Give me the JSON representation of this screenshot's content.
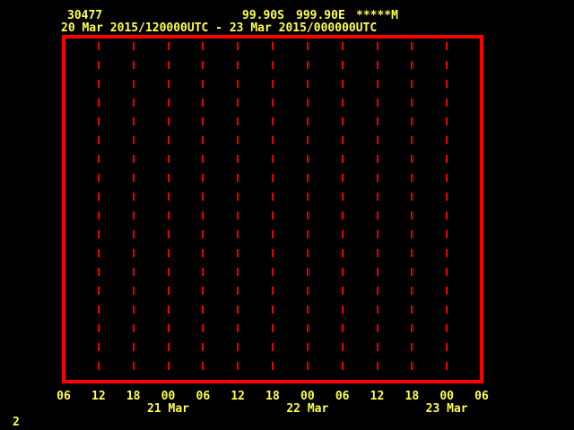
{
  "colors": {
    "background": "#000000",
    "frame": "#ff0000",
    "gridline": "#e80000",
    "text": "#ffff4d"
  },
  "header": {
    "station_id": "30477",
    "latitude": "99.90S",
    "longitude": "999.90E",
    "elevation": "*****M",
    "time_range": "20 Mar 2015/120000UTC - 23 Mar 2015/000000UTC"
  },
  "footer": {
    "page_number": "2"
  },
  "chart_data": {
    "type": "line",
    "title": "",
    "xlabel": "",
    "ylabel": "",
    "x_axis": {
      "tick_labels": [
        "06",
        "12",
        "18",
        "00",
        "06",
        "12",
        "18",
        "00",
        "06",
        "12",
        "18",
        "00",
        "06"
      ],
      "tick_interval_hours": 6,
      "date_labels": [
        {
          "label": "21 Mar",
          "tick_index": 3
        },
        {
          "label": "22 Mar",
          "tick_index": 7
        },
        {
          "label": "23 Mar",
          "tick_index": 11
        }
      ]
    },
    "gridlines": {
      "vertical_dashed_tick_indices": [
        1,
        2,
        3,
        4,
        5,
        6,
        7,
        8,
        9,
        10,
        11
      ]
    },
    "series": []
  }
}
